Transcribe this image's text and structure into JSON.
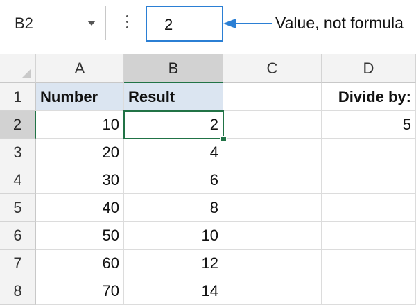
{
  "name_box": {
    "value": "B2"
  },
  "formula_bar": {
    "value": "2"
  },
  "callout": {
    "text": "Value, not formula"
  },
  "columns": [
    "A",
    "B",
    "C",
    "D"
  ],
  "selected_column": "B",
  "rows": [
    "1",
    "2",
    "3",
    "4",
    "5",
    "6",
    "7",
    "8"
  ],
  "selected_row": "2",
  "headers": {
    "a1": "Number",
    "b1": "Result",
    "d1": "Divide by:"
  },
  "divisor": {
    "d2": "5"
  },
  "data": {
    "numbers": [
      "10",
      "20",
      "30",
      "40",
      "50",
      "60",
      "70"
    ],
    "results": [
      "2",
      "4",
      "6",
      "8",
      "10",
      "12",
      "14"
    ]
  },
  "colors": {
    "accent": "#217346",
    "callout": "#2b7fd4",
    "header_fill": "#dbe5f1"
  }
}
